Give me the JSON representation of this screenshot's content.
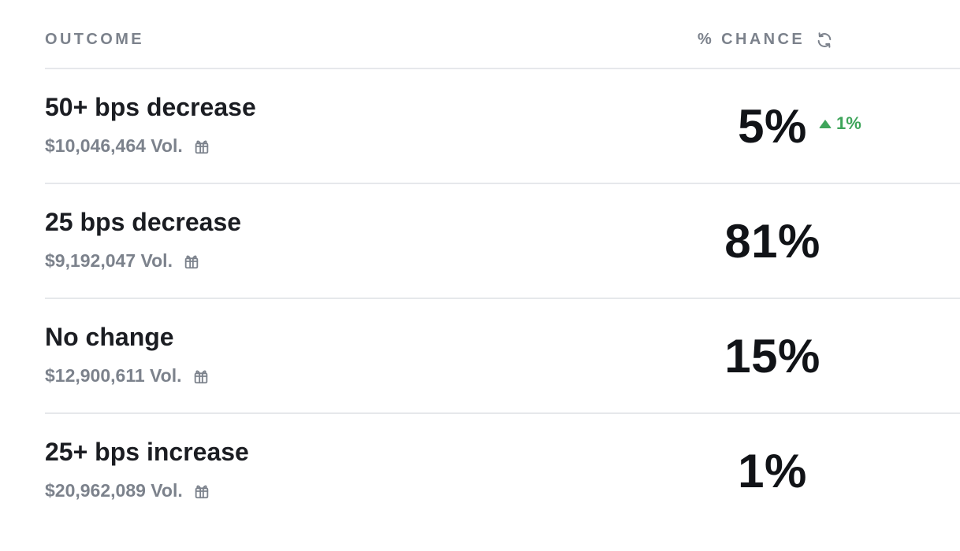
{
  "header": {
    "outcome_label": "OUTCOME",
    "chance_label": "% CHANCE",
    "refresh_icon": "refresh-icon"
  },
  "rows": [
    {
      "name": "50+ bps decrease",
      "volume": "$10,046,464 Vol.",
      "chance": "5%",
      "delta": "1%",
      "delta_direction": "up"
    },
    {
      "name": "25 bps decrease",
      "volume": "$9,192,047 Vol.",
      "chance": "81%"
    },
    {
      "name": "No change",
      "volume": "$12,900,611 Vol.",
      "chance": "15%"
    },
    {
      "name": "25+ bps increase",
      "volume": "$20,962,089 Vol.",
      "chance": "1%"
    }
  ],
  "colors": {
    "positive": "#3fa55b",
    "muted": "#7c828c",
    "divider": "#e6e8eb",
    "text": "#1b1d22"
  }
}
